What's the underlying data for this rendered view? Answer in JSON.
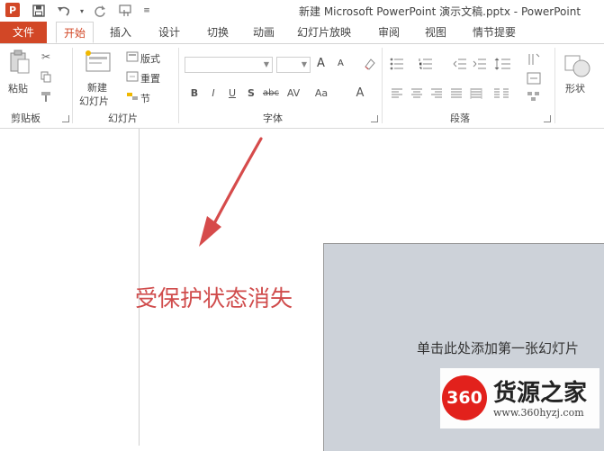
{
  "window": {
    "title": "新建 Microsoft PowerPoint 演示文稿.pptx - PowerPoint"
  },
  "app_icon": {
    "label": "P"
  },
  "quick_access": [
    "save-icon",
    "undo-icon",
    "redo-icon",
    "touch-mode-icon",
    "customize-icon"
  ],
  "tabs": [
    "文件",
    "开始",
    "插入",
    "设计",
    "切换",
    "动画",
    "幻灯片放映",
    "审阅",
    "视图",
    "情节提要"
  ],
  "ribbon": {
    "clipboard": {
      "paste_label": "粘贴",
      "group_label": "剪贴板"
    },
    "slides": {
      "new_slide_line1": "新建",
      "new_slide_line2": "幻灯片",
      "layout": "版式",
      "reset": "重置",
      "section": "节",
      "group_label": "幻灯片"
    },
    "font": {
      "group_label": "字体",
      "bold": "B",
      "italic": "I",
      "underline": "U",
      "shadow": "S",
      "strike": "abc",
      "spacing": "AV",
      "case": "Aa",
      "color": "A",
      "grow": "A",
      "shrink": "A"
    },
    "paragraph": {
      "group_label": "段落"
    },
    "drawing": {
      "shapes_label": "形状"
    }
  },
  "slide": {
    "placeholder": "单击此处添加第一张幻灯片"
  },
  "annotation": {
    "text": "受保护状态消失",
    "color": "#d04c4c"
  },
  "watermark": {
    "logo": "360",
    "name": "货源之家",
    "url": "www.360hyzj.com"
  },
  "colors": {
    "accent": "#d24726",
    "slide_bg": "#cdd2d9",
    "annotation": "#d04c4c"
  }
}
